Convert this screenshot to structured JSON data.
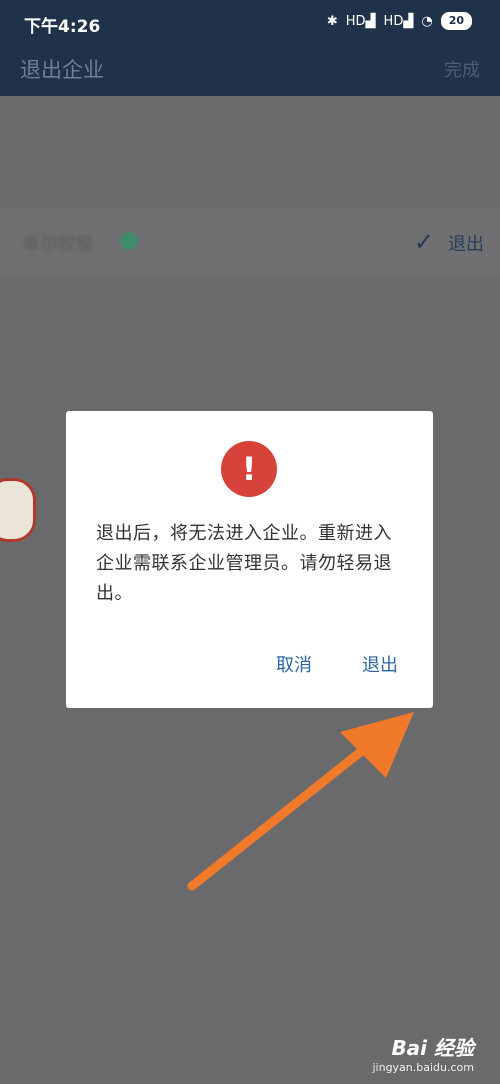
{
  "status_bar": {
    "time": "下午4:26",
    "signal_text": "HD",
    "battery": "20"
  },
  "app_bar": {
    "title": "退出企业",
    "done": "完成"
  },
  "list_row": {
    "name": "卓尔控股",
    "exit_label": "退出"
  },
  "dialog": {
    "icon_glyph": "!",
    "message": "退出后，将无法进入企业。重新进入企业需联系企业管理员。请勿轻易退出。",
    "cancel_label": "取消",
    "confirm_label": "退出"
  },
  "watermark": {
    "brand": "Bai 经验",
    "url": "jingyan.baidu.com"
  },
  "colors": {
    "accent": "#2d67a6",
    "alert": "#d7423a",
    "arrow": "#f07a2a"
  }
}
